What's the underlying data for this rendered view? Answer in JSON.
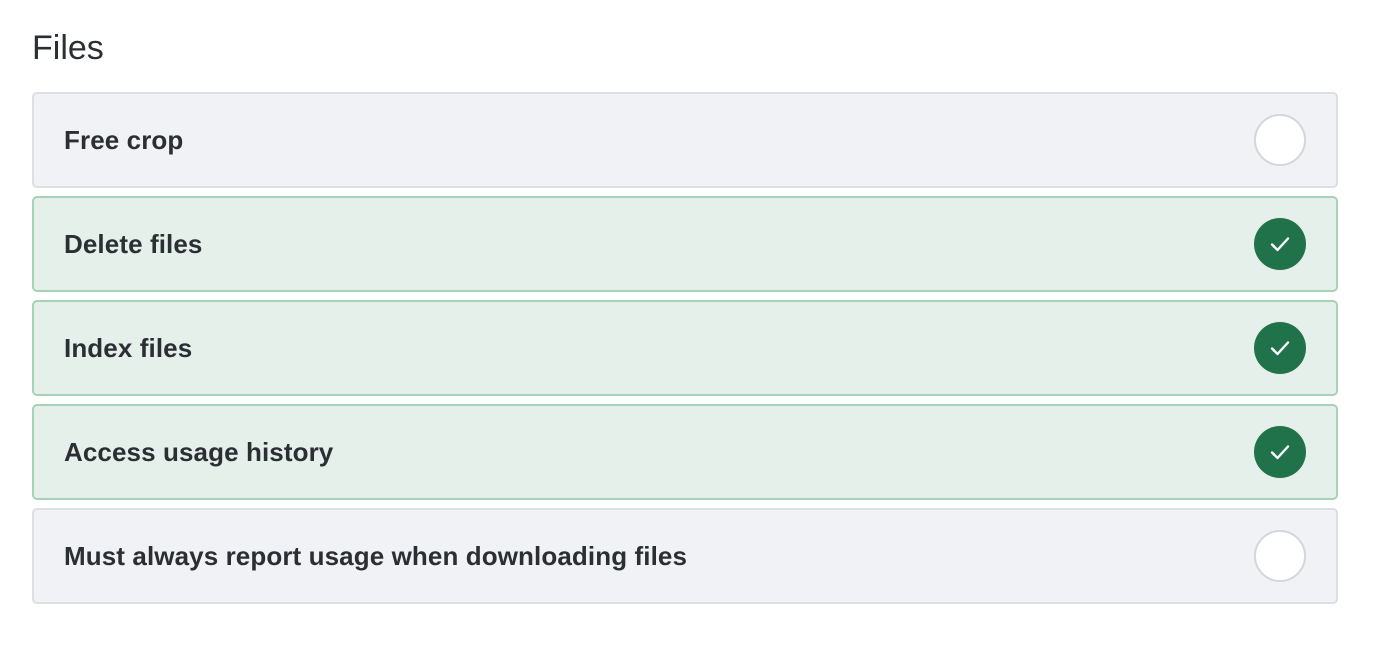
{
  "section": {
    "title": "Files"
  },
  "colors": {
    "checked_bg": "#e6f0ea",
    "checked_border": "#a9d1b6",
    "checked_indicator": "#20724a",
    "unchecked_bg": "#f1f2f6",
    "unchecked_border": "#dcdee3"
  },
  "options": [
    {
      "label": "Free crop",
      "checked": false
    },
    {
      "label": "Delete files",
      "checked": true
    },
    {
      "label": "Index files",
      "checked": true
    },
    {
      "label": "Access usage history",
      "checked": true
    },
    {
      "label": "Must always report usage when downloading files",
      "checked": false
    }
  ]
}
